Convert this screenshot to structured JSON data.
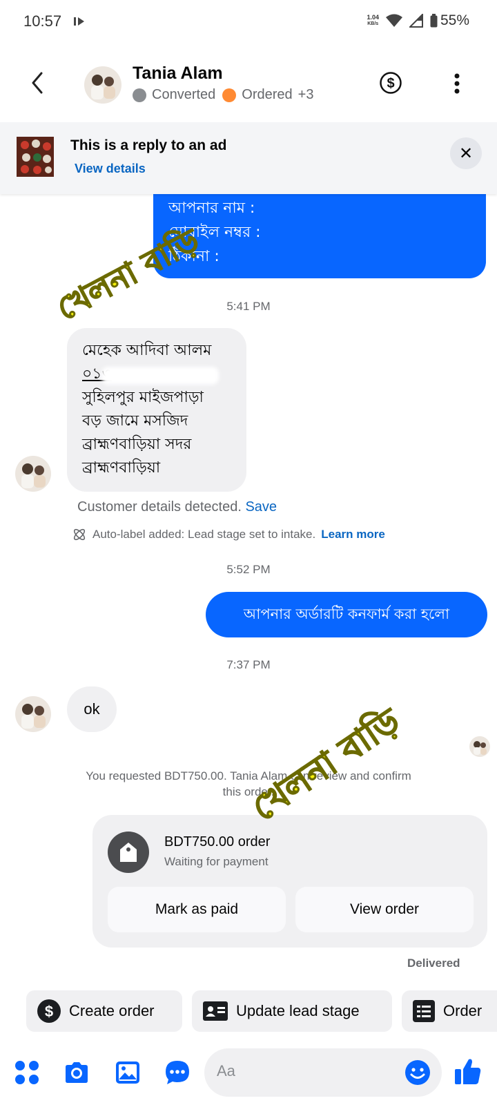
{
  "status_bar": {
    "time": "10:57",
    "net_speed_value": "1.04",
    "net_speed_unit": "KB/s",
    "battery": "55%"
  },
  "header": {
    "contact_name": "Tania Alam",
    "labels": [
      {
        "text": "Converted",
        "color": "#8a8d91"
      },
      {
        "text": "Ordered",
        "color": "#ff8a33"
      }
    ],
    "more_labels": "+3"
  },
  "ad_banner": {
    "title": "This is a reply to an ad",
    "link": "View details"
  },
  "messages": {
    "top_bubble_lines": [
      "আপনার নাম :",
      "মোবাইল নম্বর :",
      "ঠিকানা :"
    ],
    "time_1": "5:41 PM",
    "address_lines": [
      "মেহেক আদিবা আলম",
      "০১৩",
      "সুহিলপুর মাইজপাড়া",
      "বড় জামে মসজিদ",
      "ব্রাহ্মণবাড়িয়া সদর",
      "ব্রাহ্মণবাড়িয়া"
    ],
    "customer_detected": "Customer details detected.",
    "save_link": "Save",
    "auto_label": "Auto-label added: Lead stage set to intake.",
    "learn_more": "Learn more",
    "time_2": "5:52 PM",
    "confirm_message": "আপনার অর্ডারটি কনফার্ম করা হলো",
    "time_3": "7:37 PM",
    "ok_message": "ok",
    "request_note": "You requested BDT750.00. Tania Alam can review and confirm this order."
  },
  "order_card": {
    "title": "BDT750.00 order",
    "status": "Waiting for payment",
    "mark_paid": "Mark as paid",
    "view_order": "View order",
    "delivered": "Delivered"
  },
  "quick_actions": {
    "create_order": "Create order",
    "update_lead_stage": "Update lead stage",
    "order": "Order"
  },
  "composer": {
    "placeholder": "Aa"
  },
  "watermark": {
    "text": "খেলনা বাড়ি"
  },
  "colors": {
    "accent": "#0866ff",
    "link": "#0a66c2"
  }
}
